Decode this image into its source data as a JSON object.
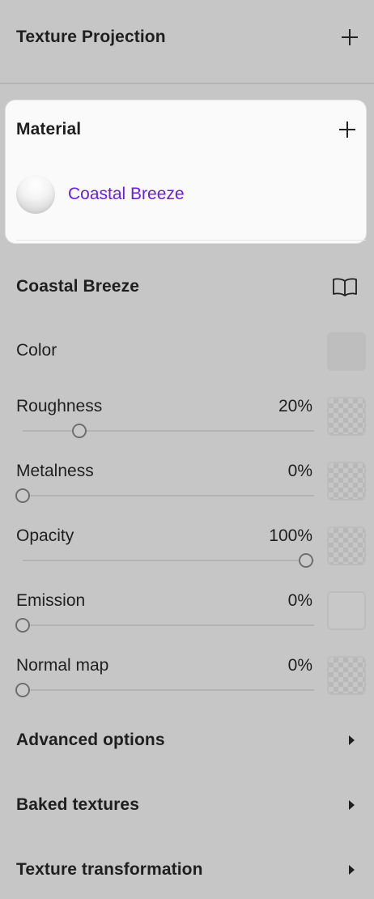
{
  "texture_projection": {
    "title": "Texture Projection",
    "add_icon": "plus-icon"
  },
  "material": {
    "title": "Material",
    "add_icon": "plus-icon",
    "selected_name": "Coastal Breeze"
  },
  "material_props": {
    "title": "Coastal Breeze",
    "docs_icon": "book-icon",
    "color_label": "Color",
    "color_swatch": "#bebebe",
    "roughness": {
      "label": "Roughness",
      "value_text": "20%",
      "value": 0.2
    },
    "metalness": {
      "label": "Metalness",
      "value_text": "0%",
      "value": 0.0
    },
    "opacity": {
      "label": "Opacity",
      "value_text": "100%",
      "value": 1.0
    },
    "emission": {
      "label": "Emission",
      "value_text": "0%",
      "value": 0.0
    },
    "normal_map": {
      "label": "Normal map",
      "value_text": "0%",
      "value": 0.0
    }
  },
  "collapsed_sections": {
    "advanced": "Advanced options",
    "baked": "Baked textures",
    "transformation": "Texture transformation"
  },
  "colors": {
    "background": "#c6c6c6",
    "card": "#fafafa",
    "accent_link": "#6a1ee0"
  }
}
